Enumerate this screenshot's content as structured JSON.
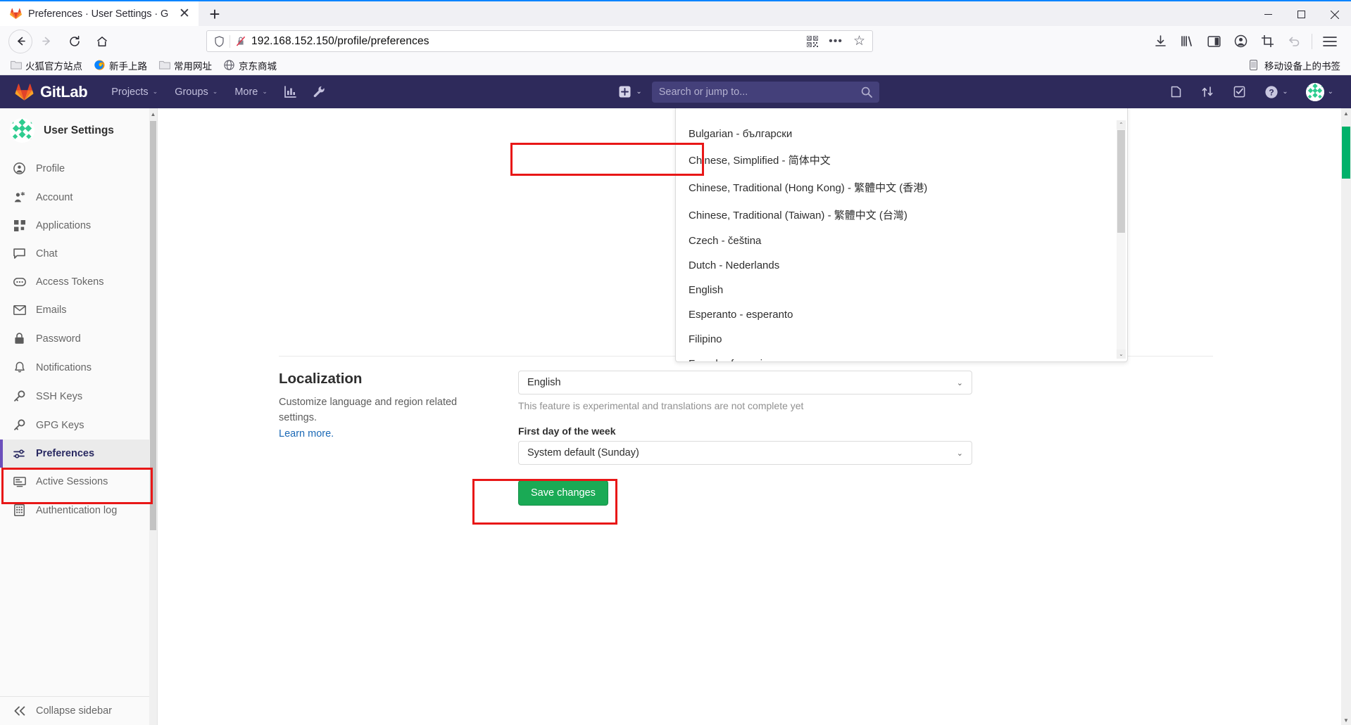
{
  "browser": {
    "tab": {
      "title": "Preferences · User Settings · G",
      "favicon": "gitlab-favicon",
      "close_label": "✕"
    },
    "newtab_label": "+",
    "window_buttons": {
      "minimize": "—",
      "maximize": "▢",
      "close": "✕"
    },
    "nav": {
      "back": "back-arrow",
      "forward": "forward-arrow",
      "reload": "reload",
      "home": "home"
    },
    "url": "192.168.152.150/profile/preferences",
    "url_icons": {
      "shield": "shield-icon",
      "lock": "lock-broken-icon",
      "qr": "qr-code-icon",
      "more": "•••",
      "star": "☆"
    },
    "toolbar_icons": [
      "downloads-icon",
      "library-icon",
      "sidebar-icon",
      "account-icon",
      "screenshot-icon",
      "undo-icon",
      "hamburger-menu-icon"
    ],
    "bookmarks": [
      {
        "label": "火狐官方站点",
        "icon": "folder-icon"
      },
      {
        "label": "新手上路",
        "icon": "firefox-icon"
      },
      {
        "label": "常用网址",
        "icon": "folder-icon"
      },
      {
        "label": "京东商城",
        "icon": "globe-icon"
      }
    ],
    "bookmarks_right": {
      "label": "移动设备上的书签",
      "icon": "mobile-icon"
    }
  },
  "gitlab_nav": {
    "brand": "GitLab",
    "links": [
      {
        "label": "Projects",
        "caret": "⌄"
      },
      {
        "label": "Groups",
        "caret": "⌄"
      },
      {
        "label": "More",
        "caret": "⌄"
      }
    ],
    "icon_links": [
      "analytics-icon",
      "wrench-icon"
    ],
    "create_new": {
      "icon": "plus-square-icon",
      "caret": "⌄"
    },
    "search": {
      "placeholder": "Search or jump to...",
      "icon": "search-icon"
    },
    "right_icons": [
      "issues-icon",
      "merge-requests-icon",
      "todos-icon"
    ],
    "help": {
      "icon": "question-circle-icon",
      "caret": "⌄"
    },
    "user": {
      "avatar": "identicon-avatar",
      "caret": "⌄"
    }
  },
  "sidebar": {
    "title": "User Settings",
    "avatar": "identicon-avatar",
    "items": [
      {
        "label": "Profile",
        "icon": "profile-icon",
        "active": false
      },
      {
        "label": "Account",
        "icon": "account-gear-icon",
        "active": false
      },
      {
        "label": "Applications",
        "icon": "applications-grid-icon",
        "active": false
      },
      {
        "label": "Chat",
        "icon": "chat-bubble-icon",
        "active": false
      },
      {
        "label": "Access Tokens",
        "icon": "token-icon",
        "active": false
      },
      {
        "label": "Emails",
        "icon": "envelope-icon",
        "active": false
      },
      {
        "label": "Password",
        "icon": "lock-icon",
        "active": false
      },
      {
        "label": "Notifications",
        "icon": "bell-icon",
        "active": false
      },
      {
        "label": "SSH Keys",
        "icon": "key-icon",
        "active": false
      },
      {
        "label": "GPG Keys",
        "icon": "key-icon",
        "active": false
      },
      {
        "label": "Preferences",
        "icon": "preferences-sliders-icon",
        "active": true
      },
      {
        "label": "Active Sessions",
        "icon": "monitor-icon",
        "active": false
      },
      {
        "label": "Authentication log",
        "icon": "log-list-icon",
        "active": false
      }
    ],
    "collapse": {
      "label": "Collapse sidebar",
      "icon": "chevron-double-left-icon"
    }
  },
  "main": {
    "localization": {
      "title": "Localization",
      "description": "Customize language and region related settings.",
      "learn_more": "Learn more.",
      "language_value": "English",
      "language_help": "This feature is experimental and translations are not complete yet",
      "first_day_label": "First day of the week",
      "first_day_value": "System default (Sunday)",
      "save_label": "Save changes",
      "chevron": "⌄"
    },
    "language_dropdown": {
      "open": true,
      "scroll_up": "⌃",
      "scroll_down": "⌄",
      "options": [
        {
          "label": "Bulgarian - български",
          "highlighted": false
        },
        {
          "label": "Chinese, Simplified - 简体中文",
          "highlighted": true
        },
        {
          "label": "Chinese, Traditional (Hong Kong) - 繁體中文 (香港)",
          "highlighted": false
        },
        {
          "label": "Chinese, Traditional (Taiwan) - 繁體中文 (台灣)",
          "highlighted": false
        },
        {
          "label": "Czech - čeština",
          "highlighted": false
        },
        {
          "label": "Dutch - Nederlands",
          "highlighted": false
        },
        {
          "label": "English",
          "highlighted": false
        },
        {
          "label": "Esperanto - esperanto",
          "highlighted": false
        },
        {
          "label": "Filipino",
          "highlighted": false
        },
        {
          "label": "French - français",
          "highlighted": false
        }
      ]
    }
  },
  "annotations": {
    "highlight_color": "#e81717",
    "boxes": [
      "chinese-simplified-option",
      "preferences-sidebar-item",
      "save-changes-button"
    ]
  },
  "colors": {
    "gitlab_navy": "#2e2a5b",
    "gitlab_green": "#1aaa55",
    "accent_purple": "#6b4fbb",
    "link_blue": "#1b69b6",
    "annotation_red": "#e81717"
  }
}
